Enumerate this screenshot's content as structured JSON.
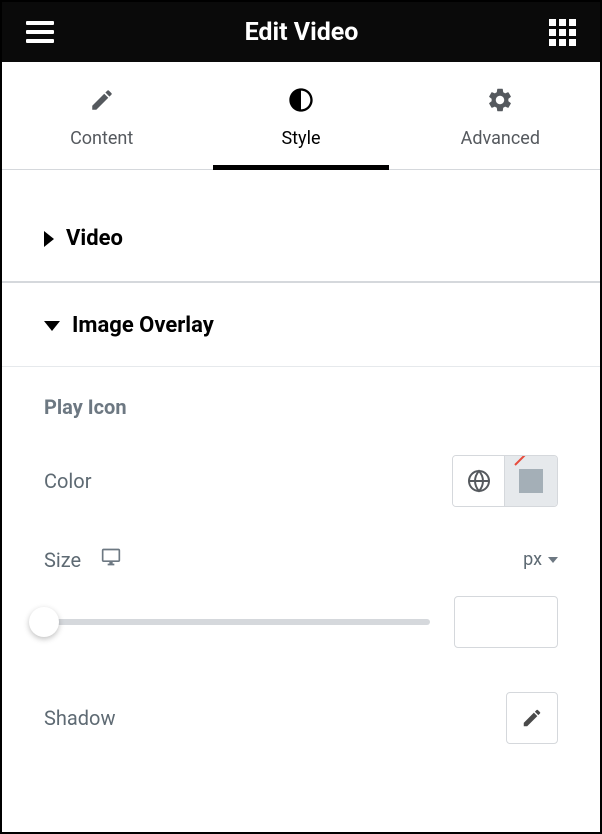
{
  "header": {
    "title": "Edit Video"
  },
  "tabs": [
    {
      "label": "Content",
      "active": false
    },
    {
      "label": "Style",
      "active": true
    },
    {
      "label": "Advanced",
      "active": false
    }
  ],
  "sections": {
    "video": {
      "title": "Video",
      "expanded": false
    },
    "imageOverlay": {
      "title": "Image Overlay",
      "expanded": true,
      "subsection": "Play Icon",
      "controls": {
        "color": {
          "label": "Color"
        },
        "size": {
          "label": "Size",
          "unit": "px",
          "value": ""
        },
        "shadow": {
          "label": "Shadow"
        }
      }
    }
  }
}
